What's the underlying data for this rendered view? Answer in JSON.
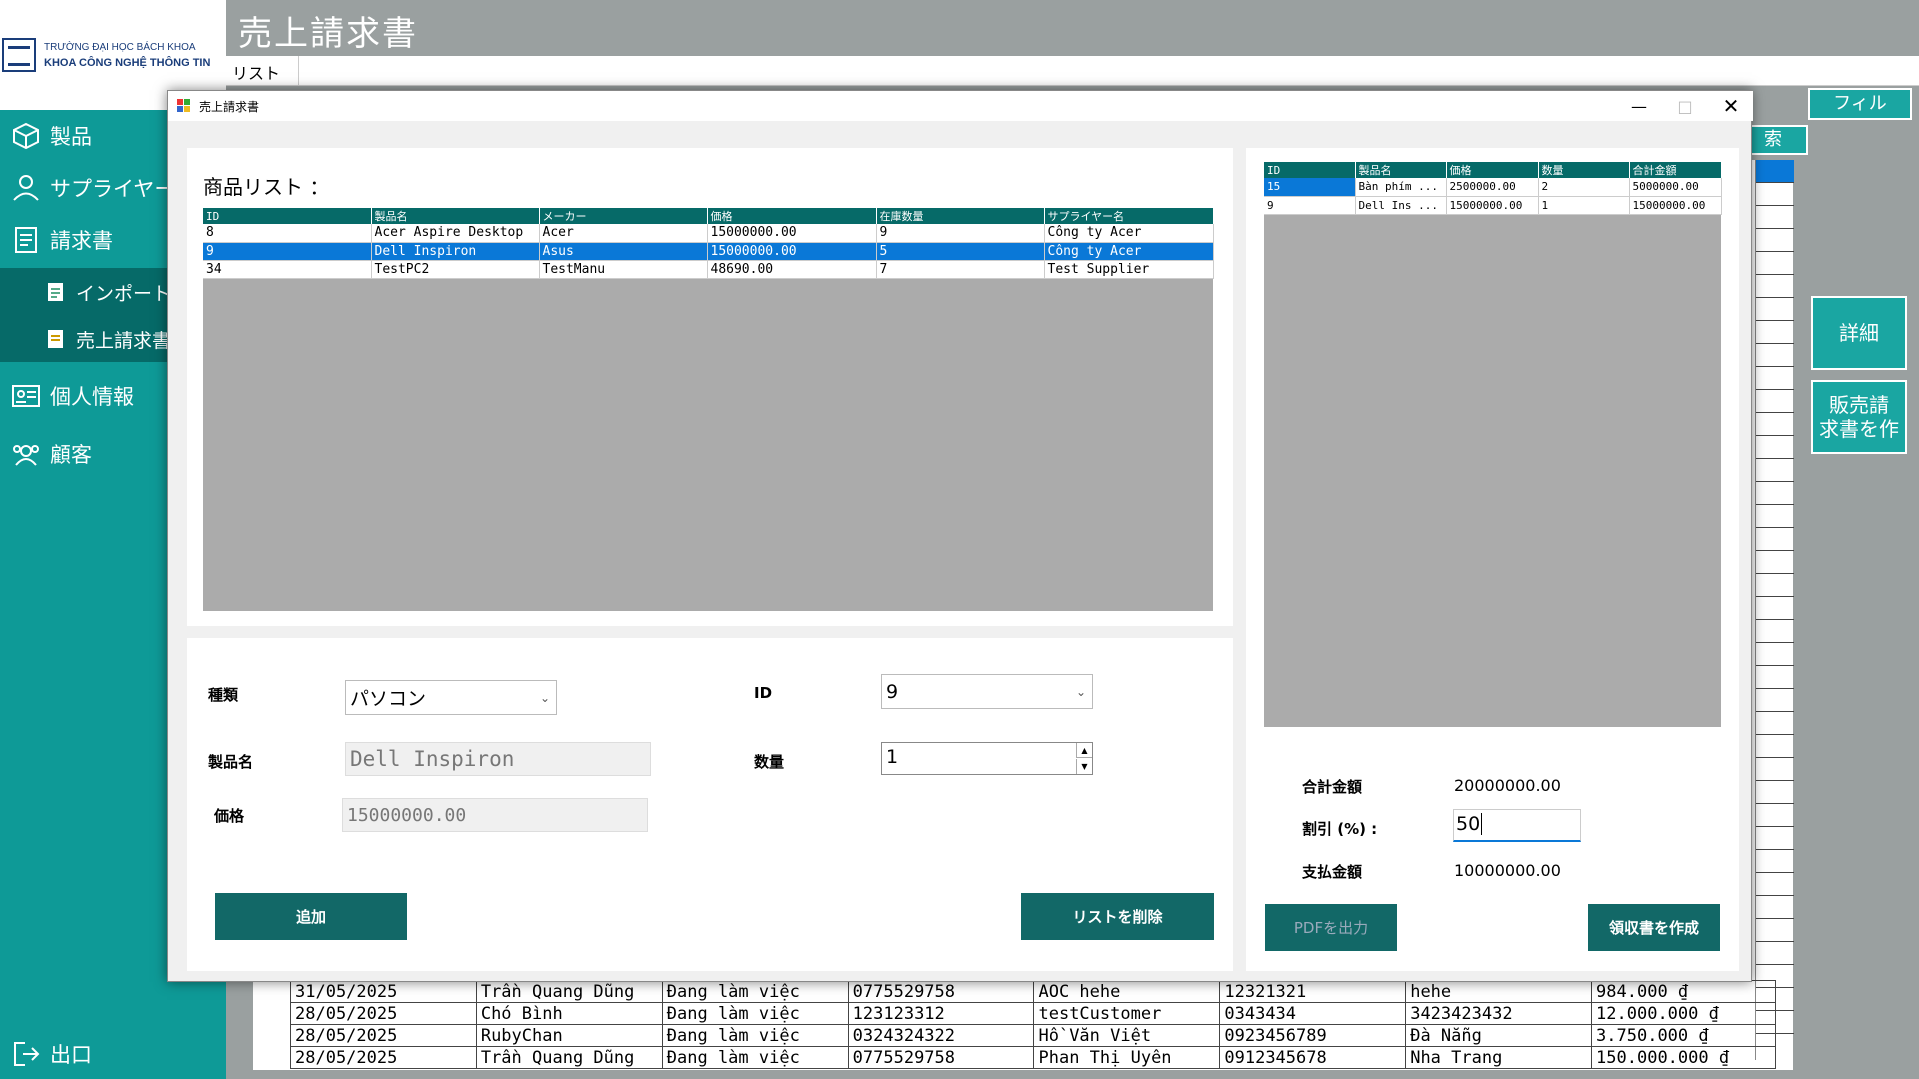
{
  "app": {
    "title": "売上請求書",
    "menu_item": "リスト",
    "logo": {
      "line1": "TRƯỜNG ĐẠI HỌC BÁCH KHOA",
      "line2": "KHOA CÔNG NGHỆ THÔNG TIN"
    }
  },
  "sidebar": {
    "items": [
      {
        "label": "製品",
        "icon": "box-icon"
      },
      {
        "label": "サプライヤー",
        "icon": "supplier-icon"
      },
      {
        "label": "請求書",
        "icon": "invoice-icon"
      },
      {
        "label": "インポート請",
        "icon": "import-doc-icon"
      },
      {
        "label": "売上請求書",
        "icon": "sales-doc-icon"
      },
      {
        "label": "個人情報",
        "icon": "id-card-icon"
      },
      {
        "label": "顧客",
        "icon": "customers-icon"
      }
    ],
    "exit_label": "出口"
  },
  "right_buttons": {
    "filter": "フィル",
    "search": "索",
    "detail": "詳細",
    "create_sales": "販売請\n求書を作"
  },
  "background_table": {
    "rows": [
      [
        "31/05/2025",
        "Trần Quang Dũng",
        "Đang làm việc",
        "0775529758",
        "AOC hehe",
        "12321321",
        "hehe",
        "984.000 ₫"
      ],
      [
        "28/05/2025",
        "Chó Bình",
        "Đang làm việc",
        "123123312",
        "testCustomer",
        "0343434",
        "3423423432",
        "12.000.000 ₫"
      ],
      [
        "28/05/2025",
        "RubyChan",
        "Đang làm việc",
        "0324324322",
        "Hồ Văn Việt",
        "0923456789",
        "Đà Nẵng",
        "3.750.000 ₫"
      ],
      [
        "28/05/2025",
        "Trần Quang Dũng",
        "Đang làm việc",
        "0775529758",
        "Phan Thị Uyên",
        "0912345678",
        "Nha Trang",
        "150.000.000 ₫"
      ]
    ]
  },
  "dialog": {
    "title": "売上請求書",
    "product_list_label": "商品リスト ：",
    "product_columns": [
      "ID",
      "製品名",
      "メーカー",
      "価格",
      "在庫数量",
      "サプライヤー名"
    ],
    "products": [
      [
        "8",
        "Acer Aspire Desktop",
        "Acer",
        "15000000.00",
        "9",
        "Công ty Acer"
      ],
      [
        "9",
        "Dell Inspiron",
        "Asus",
        "15000000.00",
        "5",
        "Công ty Acer"
      ],
      [
        "34",
        "TestPC2",
        "TestManu",
        "48690.00",
        "7",
        "Test Supplier"
      ]
    ],
    "selected_product_index": 1,
    "form": {
      "type_label": "種類",
      "type_value": "パソコン",
      "id_label": "ID",
      "id_value": "9",
      "name_label": "製品名",
      "name_value": "Dell Inspiron",
      "qty_label": "数量",
      "qty_value": "1",
      "price_label": "価格",
      "price_value": "15000000.00",
      "add_button": "追加",
      "delete_button": "リストを削除"
    },
    "cart_columns": [
      "ID",
      "製品名",
      "価格",
      "数量",
      "合計金額"
    ],
    "cart": [
      [
        "15",
        "Bàn phím ...",
        "2500000.00",
        "2",
        "5000000.00"
      ],
      [
        "9",
        "Dell Ins ...",
        "15000000.00",
        "1",
        "15000000.00"
      ]
    ],
    "summary": {
      "total_label": "合計金額",
      "total_value": "20000000.00",
      "discount_label": "割引 (%) :",
      "discount_value": "50",
      "pay_label": "支払金額",
      "pay_value": "10000000.00"
    },
    "pdf_button": "PDFを出力",
    "receipt_button": "領収書を作成"
  }
}
